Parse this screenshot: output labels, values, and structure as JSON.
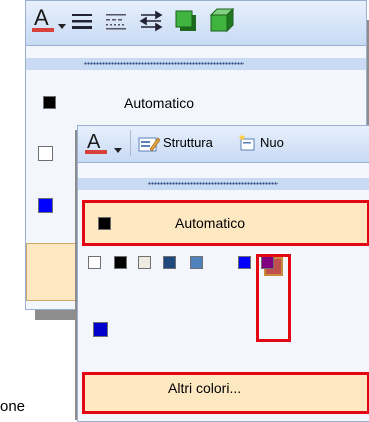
{
  "colors": {
    "accent_red": "#e30613",
    "highlight": "#fde8c2",
    "menu_bg": "#f3f7fd",
    "toolbar_bg": "#c8daf4"
  },
  "back_menu": {
    "toolbar_icons": [
      "font-color-icon",
      "dropdown-arrow-icon",
      "line-style-icon",
      "dash-style-icon",
      "arrows-icon",
      "shadow-icon",
      "3d-icon"
    ],
    "automatic_label": "Automatico"
  },
  "front_menu": {
    "toolbar": {
      "font_color_icon": "font-color-icon",
      "structure_label": "Struttura",
      "new_label": "Nuo"
    },
    "automatic_label": "Automatico",
    "swatches": [
      "#ffffff",
      "#000000",
      "#eeece1",
      "#1f497d",
      "#4f81bd",
      "#c0504d",
      "#0000ff",
      "#800080"
    ],
    "extra_swatch": "#0000cc",
    "more_colors_label": "Altri colori..."
  },
  "stray_text": "one"
}
